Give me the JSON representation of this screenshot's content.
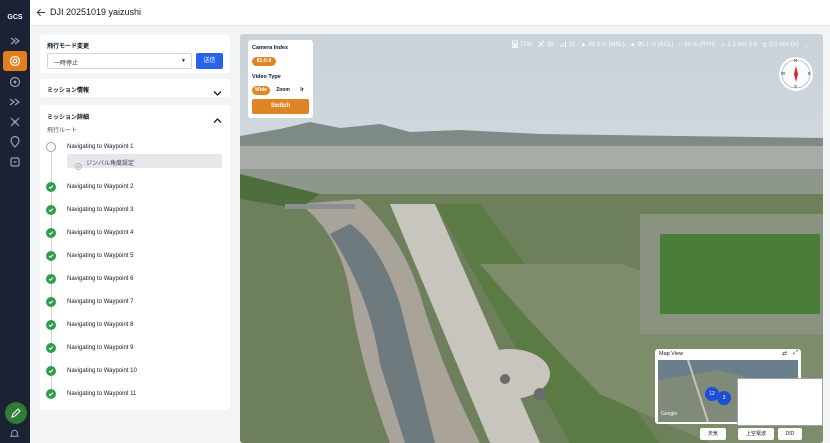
{
  "app": {
    "logo": "GCS",
    "title": "DJI 20251019 yaizushi"
  },
  "rail": {
    "items": [
      "crosshair-icon",
      "target-icon",
      "disc-icon",
      "fast-forward-icon",
      "drone-icon",
      "map-pin-icon",
      "grid-icon"
    ],
    "active": 1
  },
  "flight_mode": {
    "heading": "飛行モード変更",
    "selected": "一時停止",
    "send_label": "送信"
  },
  "mission_info": {
    "heading": "ミッション情報"
  },
  "mission_detail": {
    "heading": "ミッション詳細",
    "route_label": "飛行ルート",
    "gimbal_label": "ジンバル角度設定",
    "waypoints": [
      "Navigating to Waypoint 1",
      "Navigating to Waypoint 2",
      "Navigating to Waypoint 3",
      "Navigating to Waypoint 4",
      "Navigating to Waypoint 5",
      "Navigating to Waypoint 6",
      "Navigating to Waypoint 7",
      "Navigating to Waypoint 8",
      "Navigating to Waypoint 9",
      "Navigating to Waypoint 10",
      "Navigating to Waypoint 11"
    ]
  },
  "camera": {
    "index_label": "Camera Index",
    "index_value": "81-0-0",
    "video_type_label": "Video Type",
    "types": [
      "Wide",
      "Zoom",
      "Ir"
    ],
    "selected_type": "Wide",
    "switch_label": "Switch"
  },
  "status": {
    "battery": "72%",
    "satellites": "35",
    "signal": "32",
    "alt_msl": "40.5 m (MSL)",
    "alt_agl": "95.1 m (AGL)",
    "dist_rth": "50 m (RTH)",
    "speed_h": "1.5 m/s (H)",
    "speed_v": "0.0 m/s (V)"
  },
  "compass": {
    "n": "N",
    "e": "E",
    "s": "S",
    "w": "W"
  },
  "map": {
    "title": "Map View",
    "badges": [
      "12",
      "3"
    ],
    "attribution": "Google"
  },
  "bottom_buttons": [
    "天気",
    "上空電波",
    "DID"
  ],
  "colors": {
    "accent": "#e57e1e",
    "done": "#2e9e4a",
    "send": "#2563eb",
    "rail": "#1a2233"
  }
}
